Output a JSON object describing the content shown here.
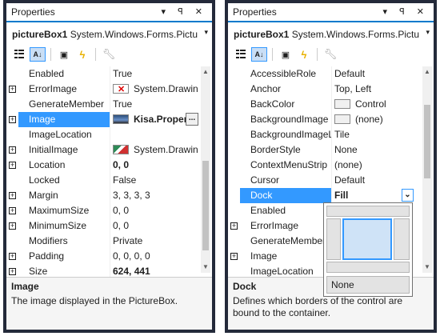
{
  "left": {
    "title": "Properties",
    "title_icons": "▾ ꟼ ✕",
    "object_name": "pictureBox1",
    "object_type": "System.Windows.Forms.Pictu",
    "rows": [
      {
        "name": "Enabled",
        "value": "True",
        "expandable": false
      },
      {
        "name": "ErrorImage",
        "value": "System.Drawing",
        "expandable": true,
        "glyph": "err"
      },
      {
        "name": "GenerateMember",
        "value": "True",
        "expandable": false
      },
      {
        "name": "Image",
        "value": "Kisa.Proper",
        "expandable": true,
        "glyph": "pic",
        "bold": true,
        "selected": true,
        "has_dots": true
      },
      {
        "name": "ImageLocation",
        "value": "",
        "expandable": false
      },
      {
        "name": "InitialImage",
        "value": "System.Drawing",
        "expandable": true,
        "glyph": "init"
      },
      {
        "name": "Location",
        "value": "0, 0",
        "expandable": true,
        "bold": true
      },
      {
        "name": "Locked",
        "value": "False",
        "expandable": false
      },
      {
        "name": "Margin",
        "value": "3, 3, 3, 3",
        "expandable": true
      },
      {
        "name": "MaximumSize",
        "value": "0, 0",
        "expandable": true
      },
      {
        "name": "MinimumSize",
        "value": "0, 0",
        "expandable": true
      },
      {
        "name": "Modifiers",
        "value": "Private",
        "expandable": false
      },
      {
        "name": "Padding",
        "value": "0, 0, 0, 0",
        "expandable": true
      },
      {
        "name": "Size",
        "value": "624, 441",
        "expandable": true,
        "bold": true
      }
    ],
    "desc_title": "Image",
    "desc_text": "The image displayed in the PictureBox."
  },
  "right": {
    "title": "Properties",
    "title_icons": "▾ ꟼ ✕",
    "object_name": "pictureBox1",
    "object_type": "System.Windows.Forms.Pictu",
    "rows": [
      {
        "name": "AccessibleRole",
        "value": "Default",
        "expandable": false
      },
      {
        "name": "Anchor",
        "value": "Top, Left",
        "expandable": false
      },
      {
        "name": "BackColor",
        "value": "Control",
        "expandable": false,
        "glyph": "swatch"
      },
      {
        "name": "BackgroundImage",
        "value": "(none)",
        "expandable": false,
        "glyph": "swatch"
      },
      {
        "name": "BackgroundImageL",
        "value": "Tile",
        "expandable": false
      },
      {
        "name": "BorderStyle",
        "value": "None",
        "expandable": false
      },
      {
        "name": "ContextMenuStrip",
        "value": "(none)",
        "expandable": false
      },
      {
        "name": "Cursor",
        "value": "Default",
        "expandable": false
      },
      {
        "name": "Dock",
        "value": "Fill",
        "expandable": false,
        "bold": true,
        "selected": true,
        "has_dropdown": true
      },
      {
        "name": "Enabled",
        "value": "",
        "expandable": false
      },
      {
        "name": "ErrorImage",
        "value": "",
        "expandable": true
      },
      {
        "name": "GenerateMember",
        "value": "",
        "expandable": false
      },
      {
        "name": "Image",
        "value": "",
        "expandable": true
      },
      {
        "name": "ImageLocation",
        "value": "",
        "expandable": false
      }
    ],
    "dock_option_none": "None",
    "desc_title": "Dock",
    "desc_text": "Defines which borders of the control are bound to the container."
  },
  "colors": {
    "selection": "#3399ff",
    "title_accent": "#007acc",
    "frame": "#242a3a",
    "fill_highlight": "#cfe3f7"
  },
  "icons": [
    "categorized-icon",
    "alphabetical-icon",
    "property-pages-icon",
    "events-icon",
    "wrench-icon"
  ]
}
